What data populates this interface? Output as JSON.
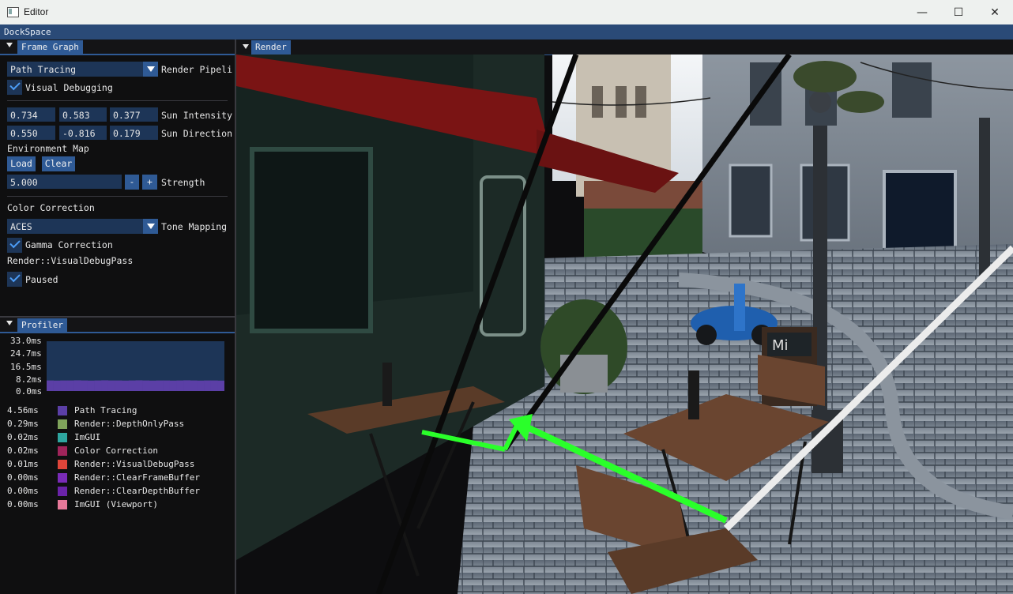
{
  "window": {
    "title": "Editor",
    "minimize": "—",
    "maximize": "☐",
    "close": "✕"
  },
  "menubar": {
    "label": "DockSpace"
  },
  "frame_graph": {
    "tab": "Frame Graph",
    "render_pipeline": {
      "value": "Path Tracing",
      "label": "Render Pipeli"
    },
    "visual_debugging": {
      "label": "Visual Debugging",
      "checked": true
    },
    "sun_intensity": {
      "values": [
        "0.734",
        "0.583",
        "0.377"
      ],
      "label": "Sun Intensity"
    },
    "sun_direction": {
      "values": [
        "0.550",
        "-0.816",
        "0.179"
      ],
      "label": "Sun Direction"
    },
    "environment_map": {
      "label": "Environment Map",
      "load": "Load",
      "clear": "Clear"
    },
    "strength": {
      "value": "5.000",
      "minus": "-",
      "plus": "+",
      "label": "Strength"
    },
    "color_correction": {
      "label": "Color Correction"
    },
    "tone_mapping": {
      "value": "ACES",
      "label": "Tone Mapping"
    },
    "gamma_correction": {
      "label": "Gamma Correction",
      "checked": true
    },
    "pass_name": "Render::VisualDebugPass",
    "paused": {
      "label": "Paused",
      "checked": true
    }
  },
  "profiler": {
    "tab": "Profiler",
    "y_ticks": [
      "33.0ms",
      "24.7ms",
      "16.5ms",
      "8.2ms",
      "0.0ms"
    ],
    "entries": [
      {
        "time": "4.56ms",
        "name": "Path Tracing",
        "color": "#5b3fa6"
      },
      {
        "time": "0.29ms",
        "name": "Render::DepthOnlyPass",
        "color": "#7fa35b"
      },
      {
        "time": "0.02ms",
        "name": "ImGUI",
        "color": "#2ea6a0"
      },
      {
        "time": "0.02ms",
        "name": "Color Correction",
        "color": "#a0245a"
      },
      {
        "time": "0.01ms",
        "name": "Render::VisualDebugPass",
        "color": "#e0453a"
      },
      {
        "time": "0.00ms",
        "name": "Render::ClearFrameBuffer",
        "color": "#7a2bb8"
      },
      {
        "time": "0.00ms",
        "name": "Render::ClearDepthBuffer",
        "color": "#6a23a8"
      },
      {
        "time": "0.00ms",
        "name": "ImGUI (Viewport)",
        "color": "#e8799a"
      }
    ],
    "chart_data": {
      "type": "area",
      "ylim": [
        0,
        33.0
      ],
      "series": [
        {
          "values": [
            4.9,
            4.8,
            4.9,
            4.9,
            5.0,
            4.9,
            4.8,
            4.9,
            5.0,
            4.9,
            4.9,
            4.8,
            4.9,
            5.0,
            4.9,
            4.8,
            4.9,
            4.9,
            4.8,
            4.9,
            5.0,
            4.9,
            4.8,
            4.9,
            4.9,
            4.8
          ]
        }
      ]
    }
  },
  "render": {
    "tab": "Render",
    "sign_text": "Mi"
  }
}
